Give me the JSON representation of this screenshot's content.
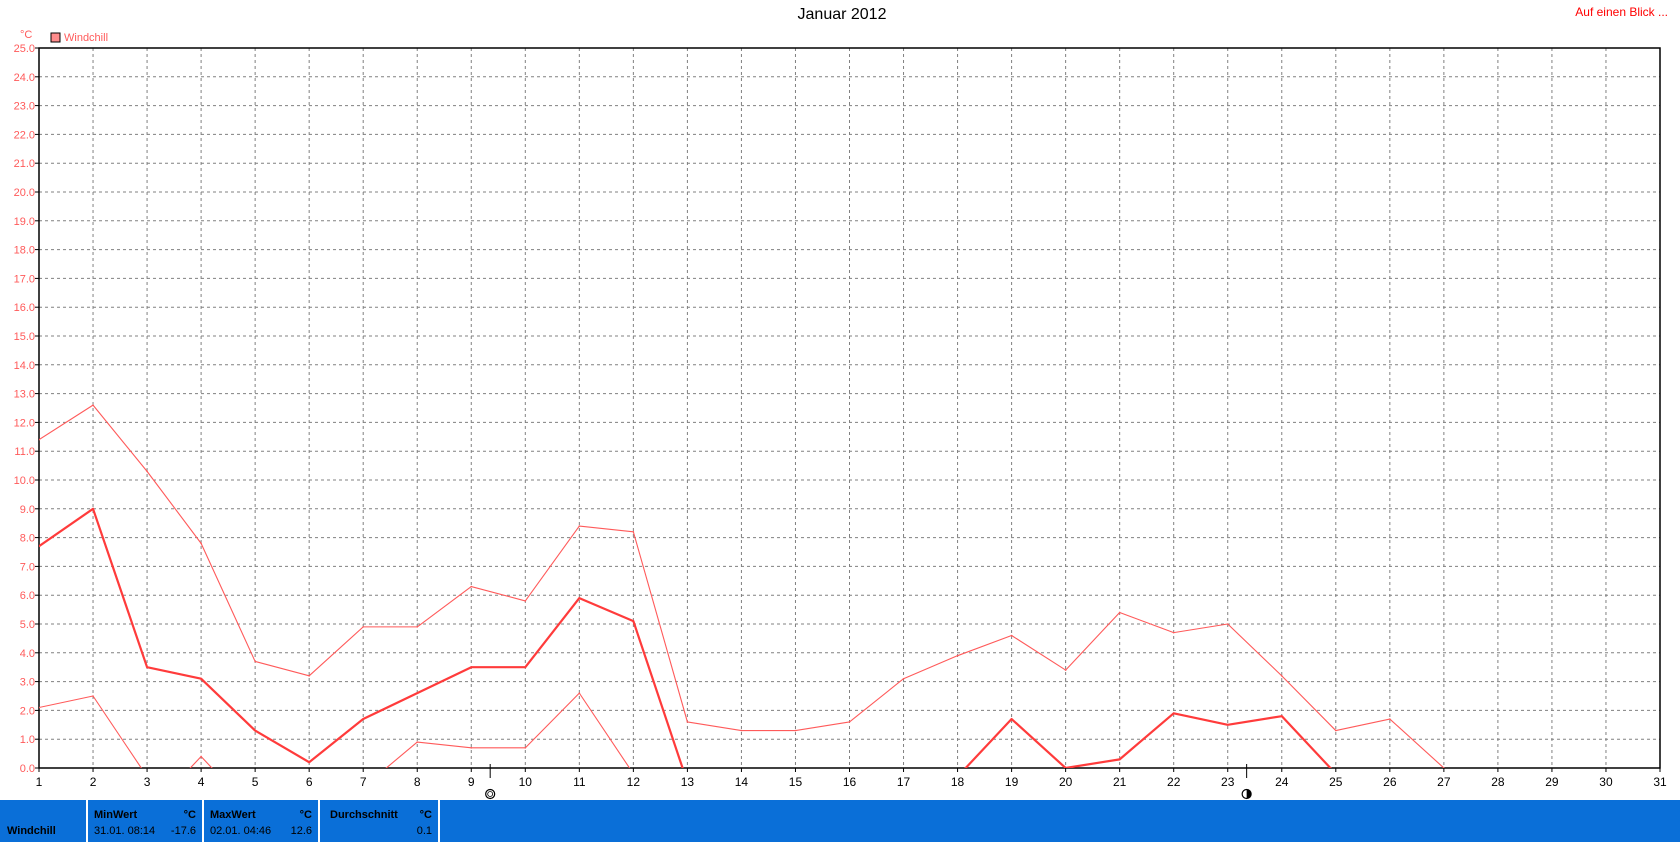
{
  "title": "Januar 2012",
  "nav_link": "Auf einen Blick ...",
  "colors": {
    "series": "#ff5a5a",
    "series_dark": "#ff3b3b",
    "footer": "#0a6fd8",
    "grid": "#808080"
  },
  "chart_data": {
    "type": "line",
    "ylabel": "°C",
    "ylim": [
      0,
      25
    ],
    "xlim": [
      1,
      31
    ],
    "grid": true,
    "legend": {
      "placement": "top-left",
      "entries": [
        "Windchill"
      ]
    },
    "y_ticks": [
      "0.0",
      "1.0",
      "2.0",
      "3.0",
      "4.0",
      "5.0",
      "6.0",
      "7.0",
      "8.0",
      "9.0",
      "10.0",
      "11.0",
      "12.0",
      "13.0",
      "14.0",
      "15.0",
      "16.0",
      "17.0",
      "18.0",
      "19.0",
      "20.0",
      "21.0",
      "22.0",
      "23.0",
      "24.0",
      "25.0"
    ],
    "x_ticks": [
      "1",
      "2",
      "3",
      "4",
      "5",
      "6",
      "7",
      "8",
      "9",
      "10",
      "11",
      "12",
      "13",
      "14",
      "15",
      "16",
      "17",
      "18",
      "19",
      "20",
      "21",
      "22",
      "23",
      "24",
      "25",
      "26",
      "27",
      "28",
      "29",
      "30",
      "31"
    ],
    "series": [
      {
        "name": "Windchill",
        "points": [
          [
            1,
            7.7
          ],
          [
            2,
            9.0
          ],
          [
            3,
            3.5
          ],
          [
            4,
            3.1
          ],
          [
            5,
            1.3
          ],
          [
            6,
            0.2
          ],
          [
            7,
            1.7
          ],
          [
            8,
            2.6
          ],
          [
            9,
            3.5
          ],
          [
            10,
            3.5
          ],
          [
            11,
            5.9
          ],
          [
            12,
            5.1
          ],
          [
            13,
            -0.5
          ],
          [
            18,
            -0.3
          ],
          [
            19,
            1.7
          ],
          [
            20,
            0.0
          ],
          [
            21,
            0.3
          ],
          [
            22,
            1.9
          ],
          [
            23,
            1.5
          ],
          [
            24,
            1.8
          ],
          [
            25,
            -0.2
          ]
        ]
      },
      {
        "name": "Max",
        "points": [
          [
            1,
            11.4
          ],
          [
            2,
            12.6
          ],
          [
            3,
            10.3
          ],
          [
            4,
            7.8
          ],
          [
            5,
            3.7
          ],
          [
            6,
            3.2
          ],
          [
            7,
            4.9
          ],
          [
            8,
            4.9
          ],
          [
            9,
            6.3
          ],
          [
            10,
            5.8
          ],
          [
            11,
            8.4
          ],
          [
            12,
            8.2
          ],
          [
            13,
            1.6
          ],
          [
            14,
            1.3
          ],
          [
            15,
            1.3
          ],
          [
            16,
            1.6
          ],
          [
            17,
            3.1
          ],
          [
            18,
            3.9
          ],
          [
            19,
            4.6
          ],
          [
            20,
            3.4
          ],
          [
            21,
            5.4
          ],
          [
            22,
            4.7
          ],
          [
            23,
            5.0
          ],
          [
            24,
            3.2
          ],
          [
            25,
            1.3
          ],
          [
            26,
            1.7
          ],
          [
            27,
            0.0
          ]
        ]
      },
      {
        "name": "Min",
        "points": [
          [
            1,
            2.1
          ],
          [
            2,
            2.5
          ],
          [
            3,
            -0.3
          ]
        ]
      },
      {
        "name": "Min",
        "points": [
          [
            3.7,
            -0.2
          ],
          [
            4,
            0.4
          ],
          [
            4.3,
            -0.2
          ]
        ]
      },
      {
        "name": "Min",
        "points": [
          [
            7.3,
            -0.2
          ],
          [
            8,
            0.9
          ],
          [
            9,
            0.7
          ],
          [
            10,
            0.7
          ],
          [
            11,
            2.6
          ],
          [
            12,
            -0.2
          ]
        ]
      }
    ],
    "moon_markers": [
      {
        "x": 9.35,
        "phase": "full"
      },
      {
        "x": 23.35,
        "phase": "new"
      }
    ]
  },
  "footer": {
    "row_label": "Windchill",
    "min": {
      "label": "MinWert",
      "unit": "°C",
      "date": "31.01.  08:14",
      "value": "-17.6"
    },
    "max": {
      "label": "MaxWert",
      "unit": "°C",
      "date": "02.01.  04:46",
      "value": "12.6"
    },
    "avg": {
      "label": "Durchschnitt",
      "unit": "°C",
      "value": "0.1"
    }
  }
}
